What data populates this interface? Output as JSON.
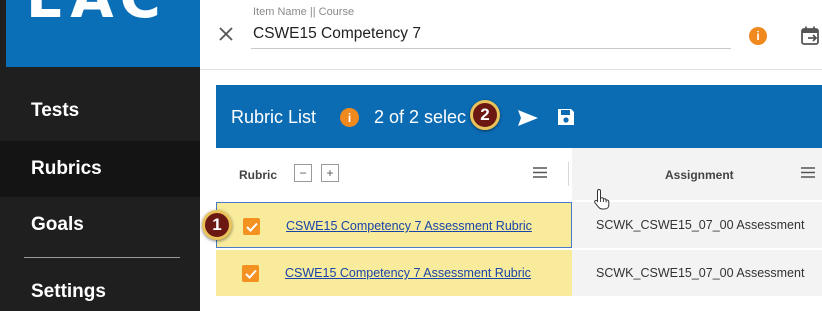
{
  "app": {
    "logo": "EAC"
  },
  "sidebar": {
    "items": [
      {
        "label": "Tests"
      },
      {
        "label": "Rubrics"
      },
      {
        "label": "Goals"
      },
      {
        "label": "Settings"
      }
    ]
  },
  "header": {
    "item_label": "Item Name || Course",
    "item_value": "CSWE15 Competency 7",
    "info_icon": "i"
  },
  "rubric_list": {
    "title": "Rubric List",
    "info_icon": "i",
    "selection_text": "2 of 2 selec"
  },
  "annotations": {
    "step1": "1",
    "step2": "2"
  },
  "grid": {
    "headers": {
      "rubric": "Rubric",
      "assignment": "Assignment",
      "collapse": "−",
      "expand": "+"
    },
    "rows": [
      {
        "rubric": "CSWE15 Competency 7 Assessment Rubric",
        "assignment": "SCWK_CSWE15_07_00 Assessment"
      },
      {
        "rubric": "CSWE15 Competency 7 Assessment Rubric",
        "assignment": "SCWK_CSWE15_07_00 Assessment"
      }
    ]
  },
  "colors": {
    "brand_blue": "#0b6cb4",
    "sidebar_bg": "#1f1f1f",
    "accent_orange": "#f0891e",
    "selected_row": "#f8eb9c",
    "link": "#1a44a8"
  },
  "icons": {
    "close": "close-icon",
    "info": "info-icon",
    "calendar": "calendar-arrow-icon",
    "send": "send-icon",
    "save": "save-icon",
    "menu": "menu-icon",
    "checkbox": "checkbox-checked-icon",
    "cursor": "hand-cursor-icon"
  }
}
